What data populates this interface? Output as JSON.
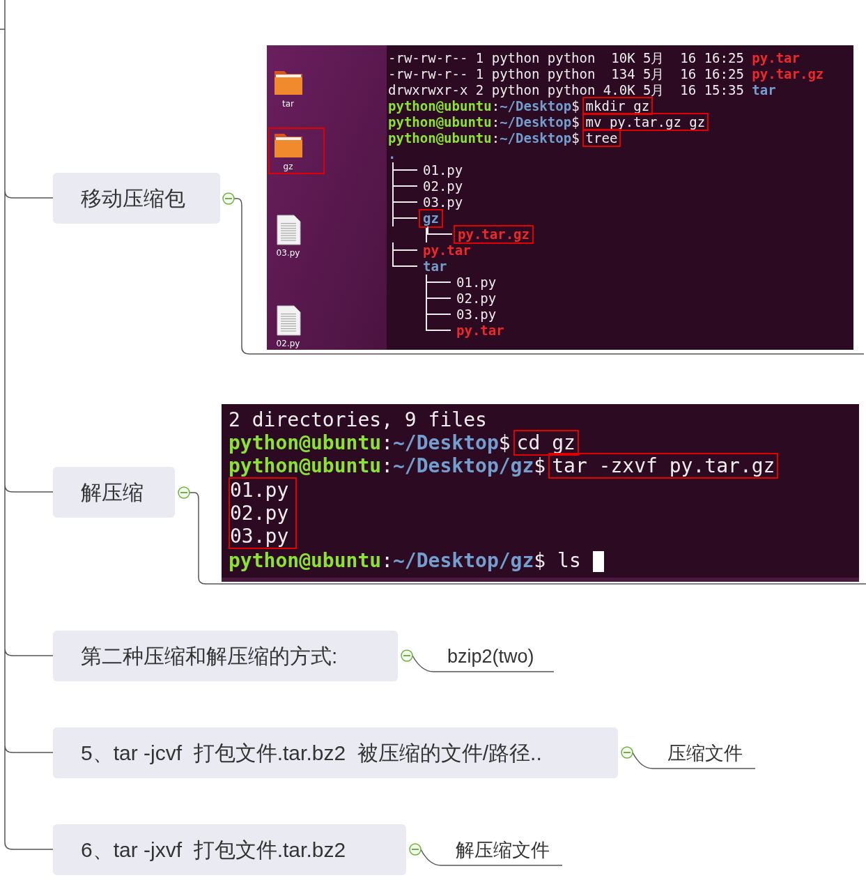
{
  "topics": [
    {
      "label": "移动压缩包",
      "expanded": true,
      "attachment": {
        "kind": "desktop-terminal",
        "desktop_icons": [
          {
            "kind": "folder",
            "label": "tar",
            "boxed": false
          },
          {
            "kind": "folder",
            "label": "gz",
            "boxed": true
          },
          {
            "kind": "file",
            "label": "03.py",
            "boxed": false
          },
          {
            "kind": "file",
            "label": "02.py",
            "boxed": false
          }
        ],
        "lines": [
          {
            "boxed": false,
            "segments": [
              {
                "text": "-rw-rw-r-- 1 python python  10K 5月  16 16:25 ",
                "kind": "plain",
                "boxed": false
              },
              {
                "text": "py.tar",
                "kind": "archive",
                "boxed": false
              }
            ]
          },
          {
            "boxed": false,
            "segments": [
              {
                "text": "-rw-rw-r-- 1 python python  134 5月  16 16:25 ",
                "kind": "plain",
                "boxed": false
              },
              {
                "text": "py.tar.gz",
                "kind": "archive",
                "boxed": false
              }
            ]
          },
          {
            "boxed": false,
            "segments": [
              {
                "text": "drwxrwxr-x 2 python python 4.0K 5月  16 15:35 ",
                "kind": "plain",
                "boxed": false
              },
              {
                "text": "tar",
                "kind": "dir",
                "boxed": false
              }
            ]
          },
          {
            "boxed": false,
            "segments": [
              {
                "text": "python@ubuntu",
                "kind": "user",
                "boxed": false
              },
              {
                "text": ":",
                "kind": "plain",
                "boxed": false
              },
              {
                "text": "~/Desktop",
                "kind": "path",
                "boxed": false
              },
              {
                "text": "$",
                "kind": "plain",
                "boxed": false
              },
              {
                "text": "mkdir gz",
                "kind": "plain",
                "boxed": true
              }
            ]
          },
          {
            "boxed": false,
            "segments": [
              {
                "text": "python@ubuntu",
                "kind": "user",
                "boxed": false
              },
              {
                "text": ":",
                "kind": "plain",
                "boxed": false
              },
              {
                "text": "~/Desktop",
                "kind": "path",
                "boxed": false
              },
              {
                "text": "$",
                "kind": "plain",
                "boxed": false
              },
              {
                "text": "mv py.tar.gz gz",
                "kind": "plain",
                "boxed": true
              }
            ]
          },
          {
            "boxed": false,
            "segments": [
              {
                "text": "python@ubuntu",
                "kind": "user",
                "boxed": false
              },
              {
                "text": ":",
                "kind": "plain",
                "boxed": false
              },
              {
                "text": "~/Desktop",
                "kind": "path",
                "boxed": false
              },
              {
                "text": "$",
                "kind": "plain",
                "boxed": false
              },
              {
                "text": "tree",
                "kind": "plain",
                "boxed": true
              }
            ]
          }
        ],
        "tree": {
          "name": ".",
          "kind": "dir",
          "children": [
            {
              "name": "01.py",
              "kind": "plain",
              "boxed": false
            },
            {
              "name": "02.py",
              "kind": "plain",
              "boxed": false
            },
            {
              "name": "03.py",
              "kind": "plain",
              "boxed": false
            },
            {
              "name": "gz",
              "kind": "dir",
              "boxed": true,
              "children": [
                {
                  "name": "py.tar.gz",
                  "kind": "archive",
                  "boxed": true
                }
              ]
            },
            {
              "name": "py.tar",
              "kind": "archive",
              "boxed": false
            },
            {
              "name": "tar",
              "kind": "dir",
              "boxed": false,
              "children": [
                {
                  "name": "01.py",
                  "kind": "plain",
                  "boxed": false
                },
                {
                  "name": "02.py",
                  "kind": "plain",
                  "boxed": false
                },
                {
                  "name": "03.py",
                  "kind": "plain",
                  "boxed": false
                },
                {
                  "name": "py.tar",
                  "kind": "archive",
                  "boxed": false
                }
              ]
            }
          ]
        }
      }
    },
    {
      "label": "解压缩",
      "expanded": true,
      "attachment": {
        "kind": "terminal",
        "cursor": true,
        "lines": [
          {
            "boxed": false,
            "segments": [
              {
                "text": "2 directories, 9 files",
                "kind": "plain",
                "boxed": false
              }
            ]
          },
          {
            "boxed": false,
            "segments": [
              {
                "text": "python@ubuntu",
                "kind": "user",
                "boxed": false
              },
              {
                "text": ":",
                "kind": "plain",
                "boxed": false
              },
              {
                "text": "~/Desktop",
                "kind": "path",
                "boxed": false
              },
              {
                "text": "$",
                "kind": "plain",
                "boxed": false
              },
              {
                "text": "cd gz",
                "kind": "plain",
                "boxed": true
              }
            ]
          },
          {
            "boxed": false,
            "segments": [
              {
                "text": "python@ubuntu",
                "kind": "user",
                "boxed": false
              },
              {
                "text": ":",
                "kind": "plain",
                "boxed": false
              },
              {
                "text": "~/Desktop/gz",
                "kind": "path",
                "boxed": false
              },
              {
                "text": "$",
                "kind": "plain",
                "boxed": false
              },
              {
                "text": "tar -zxvf py.tar.gz",
                "kind": "plain",
                "boxed": true
              }
            ]
          },
          {
            "boxed": true,
            "segments": [
              {
                "text": "01.py",
                "kind": "plain",
                "boxed": false
              }
            ]
          },
          {
            "boxed": true,
            "segments": [
              {
                "text": "02.py",
                "kind": "plain",
                "boxed": false
              }
            ]
          },
          {
            "boxed": true,
            "segments": [
              {
                "text": "03.py",
                "kind": "plain",
                "boxed": false
              }
            ]
          },
          {
            "boxed": false,
            "segments": [
              {
                "text": "python@ubuntu",
                "kind": "user",
                "boxed": false
              },
              {
                "text": ":",
                "kind": "plain",
                "boxed": false
              },
              {
                "text": "~/Desktop/gz",
                "kind": "path",
                "boxed": false
              },
              {
                "text": "$ ls ",
                "kind": "plain",
                "boxed": false
              }
            ]
          }
        ]
      }
    },
    {
      "label": "第二种压缩和解压缩的方式:",
      "expanded": true,
      "subtopic": "bzip2(two)"
    },
    {
      "label": "5、tar -jcvf  打包文件.tar.bz2  被压缩的文件/路径..",
      "expanded": true,
      "subtopic": "压缩文件"
    },
    {
      "label": "6、tar -jxvf  打包文件.tar.bz2",
      "expanded": true,
      "subtopic": "解压缩文件"
    }
  ]
}
